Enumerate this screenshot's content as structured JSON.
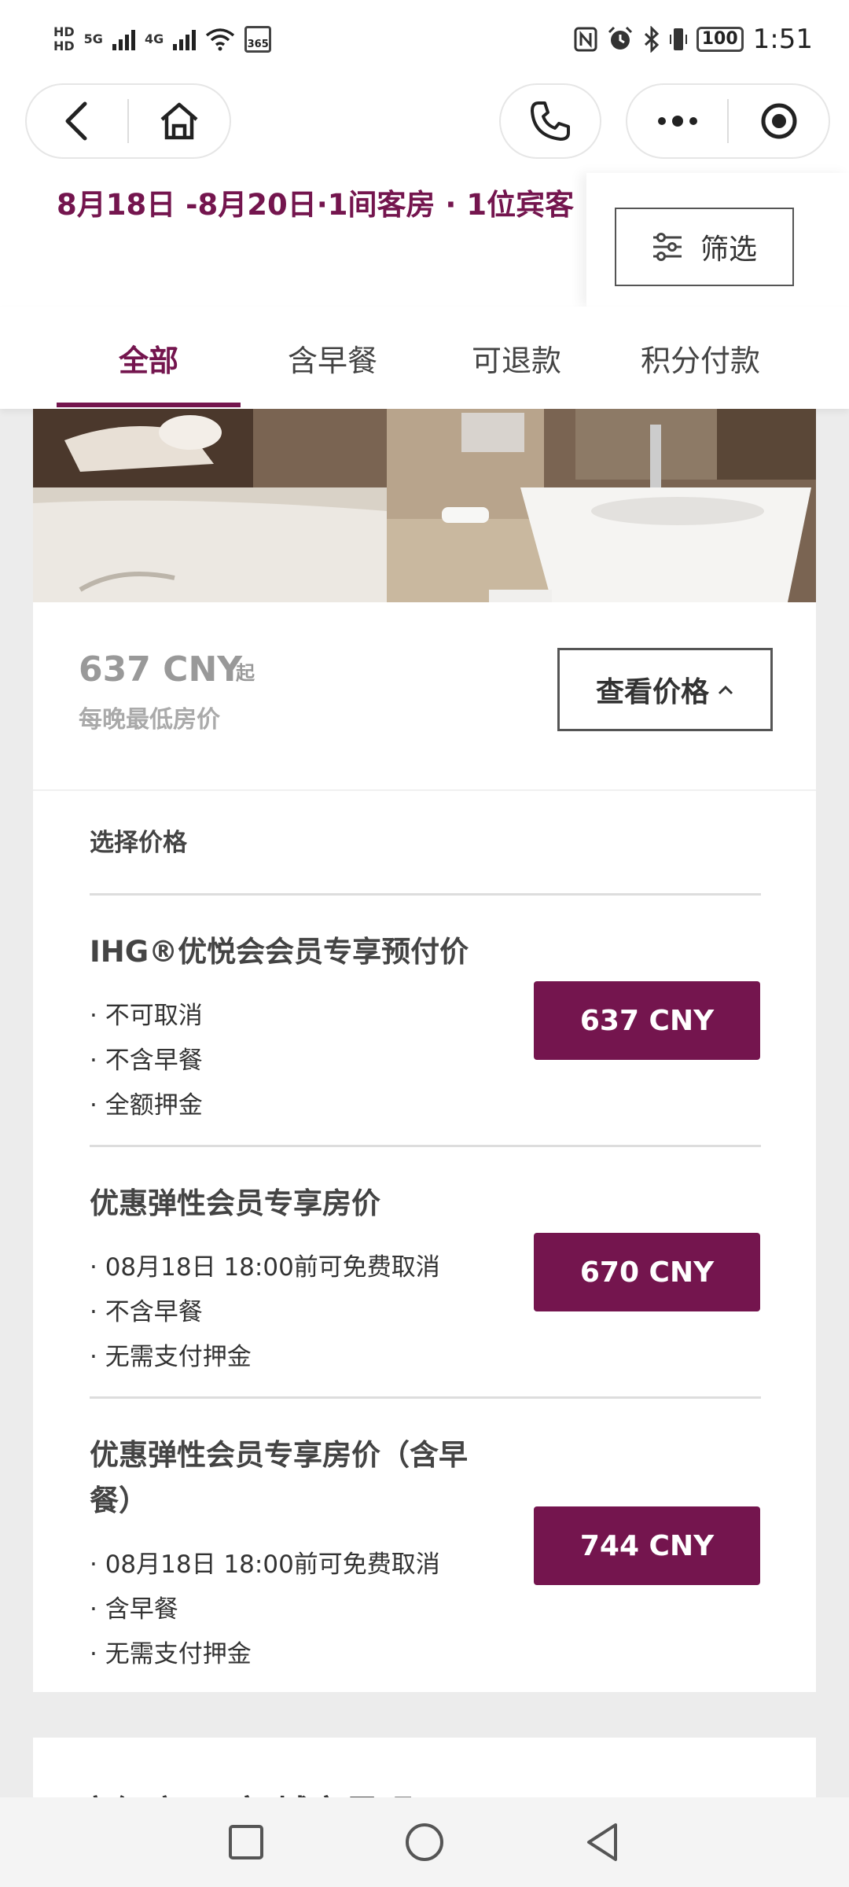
{
  "status_bar": {
    "time": "1:51",
    "battery": "100",
    "net_5g": "5G",
    "net_4g": "4G",
    "hd": "HD",
    "calendar_badge": "365"
  },
  "nav": {
    "back_icon": "chevron-left-icon",
    "home_icon": "home-icon",
    "phone_icon": "phone-icon",
    "more_icon": "more-dots-icon",
    "target_icon": "target-icon"
  },
  "header": {
    "date_summary": "8月18日 -8月20日·1间客房 · 1位宾客",
    "filter_label": "筛选"
  },
  "tabs": [
    {
      "label": "全部",
      "active": true
    },
    {
      "label": "含早餐",
      "active": false
    },
    {
      "label": "可退款",
      "active": false
    },
    {
      "label": "积分付款",
      "active": false
    }
  ],
  "room_card": {
    "price": "637 CNY",
    "price_suffix": "起",
    "price_note": "每晚最低房价",
    "view_price_label": "查看价格",
    "rates_title": "选择价格",
    "rates": [
      {
        "name": "IHG®优悦会会员专享预付价",
        "lines": [
          "· 不可取消",
          "· 不含早餐",
          "· 全额押金"
        ],
        "price": "637 CNY"
      },
      {
        "name": "优惠弹性会员专享房价",
        "lines": [
          "· 08月18日 18:00前可免费取消",
          "· 不含早餐",
          "· 无需支付押金"
        ],
        "price": "670 CNY"
      },
      {
        "name": "优惠弹性会员专享房价（含早餐）",
        "lines": [
          "· 08月18日 18:00前可免费取消",
          "· 含早餐",
          "· 无需支付押金"
        ],
        "price": "744 CNY"
      }
    ]
  },
  "next_card": {
    "title": "高级房 双床 城市景观"
  },
  "colors": {
    "brand": "#74154e",
    "background": "#ececec"
  }
}
